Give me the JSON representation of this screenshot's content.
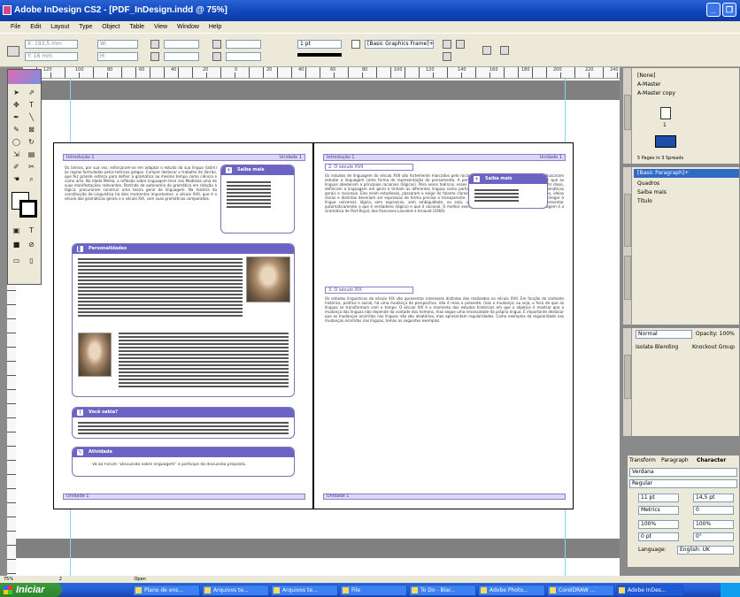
{
  "window": {
    "title": "Adobe InDesign CS2 - [PDF_InDesign.indd @ 75%]"
  },
  "menu": [
    "File",
    "Edit",
    "Layout",
    "Type",
    "Object",
    "Table",
    "View",
    "Window",
    "Help"
  ],
  "control": {
    "x": "X: 193,5 mm",
    "y": "Y: 16 mm",
    "w": "W:",
    "h": "H:",
    "stroke_weight": "1 pt",
    "frame_style": "[Basic Graphics Frame]+"
  },
  "ruler": [
    "120",
    "100",
    "80",
    "60",
    "40",
    "20",
    "0",
    "20",
    "40",
    "60",
    "80",
    "100",
    "120",
    "140",
    "160",
    "180",
    "200",
    "220",
    "240"
  ],
  "left_page": {
    "header": "Introdução 1",
    "header_right": "Unidade 1",
    "intro": "Os latinos, por sua vez, esforçaram-se em adaptar o estudo da sua língua (latim) às regras formuladas pelos teóricos gregos. Cumpre destacar o trabalho de Varrão, que fez grande esforço para definir a gramática ao mesmo tempo como ciência e como arte. Na Idade Média, a reflexão sobre linguagem teve nos Modistas uma de suas manifestações relevantes. Partindo da autonomia da gramática em relação à lógica, procuraram construir uma teoria geral da linguagem. Na história da constituição da Linguística há dois momentos importantes: o século XVII, que é o século das gramáticas gerais e o século XIX, com suas gramáticas comparadas.",
    "saiba_mais": "Saiba mais",
    "personalidades": "Personalidades",
    "voce_sabia": "Você sabia?",
    "atividade": "Atividade",
    "atividade_text": "Vá ao Fórum \"Discussão sobre linguagem\" e participe da discussão proposta.",
    "footer": "Unidade 1"
  },
  "right_page": {
    "header": "Introdução 1",
    "header_right": "Unidade 1",
    "sec1": "2. O século XVII",
    "text1": "Os estudos de linguagem do século XVII são fortemente marcados pelo racionalismo. Naquele período, os estudiosos buscaram estudar a linguagem como forma de representação do pensamento. A partir desse pressuposto, procuraram mostrar que as línguas obedecem a princípios racionais (lógicos). Para esses teóricos, esses princípios regeriam todas as línguas. A partir disso, definiram a linguagem em geral e tinham as diferentes línguas como particularidades delas. Com isso, chamaram gramáticas gerais e racionais. Eles eram estudiosos, passaram a exigir do falante clareza e precisão no uso da linguagem. Para eles, ideias claras e distintas deveriam ser expressas de forma precisa e transparente. O objetivo (o alvo) desses estudiosos era chegar à língua universal, lógica, sem equívocos, sem ambiguidade, ou seja, uma espécie de língua que pudesse apresentar automaticamente o que é verdadeiro (lógico) e que é racional. O melhor exemplo desse direito de abordagem da linguagem é a Gramática de Port-Royal, dos franceses Lancelot e Arnauld (1660).",
    "saiba_mais": "Saiba mais",
    "sec2": "3. O século XIX",
    "text2": "Os estudos linguísticos do século XIX vão apresentar interesses distintos dos realizados no século XVII. Em função do contexto histórico, político e social, há uma mudança de perspectiva, não é mais o presente, mas a mudança; ou seja, o foco de que as línguas se transformam com o tempo. O século XIX é o momento dos estudos históricos em que o objetivo é mostrar que a mudança das línguas não depende da vontade dos homens, mas segue uma necessidade da própria língua. É importante destacar que as mudanças ocorridas nas línguas não são aleatórias, mas apresentam regularidades. Como exemplos da regularidade nas mudanças ocorridas nas línguas, temos as seguintes exemplos.",
    "footer": "Unidade 1"
  },
  "pages_panel": {
    "items": [
      "[None]",
      "A-Master",
      "A-Master copy"
    ],
    "summary": "5 Pages in 3 Spreads",
    "page_number": "1"
  },
  "para_styles": {
    "items": [
      "[Basic Paragraph]+",
      "Quadros",
      "Saiba mais",
      "Título"
    ]
  },
  "transparency": {
    "mode": "Normal",
    "opacity": "Opacity: 100%",
    "isolate": "Isolate Blending",
    "knockout": "Knockout Group"
  },
  "character": {
    "tabs": [
      "Transform",
      "Paragraph",
      "Character"
    ],
    "font": "Verdana",
    "style": "Regular",
    "size": "11 pt",
    "leading": "14,5 pt",
    "kerning": "Metrics",
    "tracking": "0",
    "vscale": "100%",
    "hscale": "100%",
    "baseline": "0 pt",
    "skew": "0°",
    "language_label": "Language:",
    "language": "English: UK"
  },
  "status": {
    "zoom": "75%",
    "page": "2",
    "open": "Open"
  },
  "taskbar": {
    "start": "Iniciar",
    "items": [
      "Plano de ens...",
      "Arquivos te...",
      "Arquivos te...",
      "File",
      "To Do - Blar...",
      "Adobe Photo...",
      "CorelDRAW ...",
      "Adobe InDes..."
    ]
  }
}
